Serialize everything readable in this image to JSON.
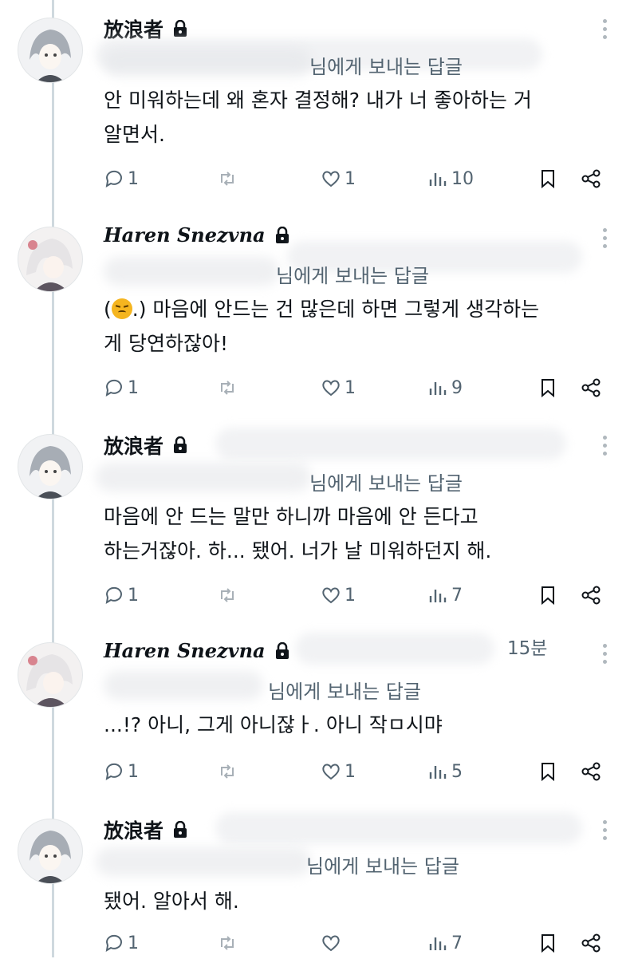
{
  "thread": [
    {
      "author": "放浪者",
      "author_style": "sans",
      "locked": true,
      "time": "",
      "reply_to": "님에게 보내는 답글",
      "text": "안 미워하는데 왜 혼자 결정해? 내가 너 좋아하는 거\n알면서.",
      "emoji_prefix": false,
      "text_after_emoji": "",
      "replies": "1",
      "retweets": "",
      "likes": "1",
      "views": "10"
    },
    {
      "author": "Haren Snezvna",
      "author_style": "serif",
      "locked": true,
      "time": "",
      "reply_to": "님에게 보내는 답글",
      "text": "(",
      "emoji_prefix": true,
      "text_after_emoji": ".) 마음에 안드는 건 많은데 하면 그렇게 생각하는\n게 당연하잖아!",
      "replies": "1",
      "retweets": "",
      "likes": "1",
      "views": "9"
    },
    {
      "author": "放浪者",
      "author_style": "sans",
      "locked": true,
      "time": "",
      "reply_to": "님에게 보내는 답글",
      "text": "마음에 안 드는 말만 하니까 마음에 안 든다고\n하는거잖아. 하... 됐어. 너가 날 미워하던지 해.",
      "emoji_prefix": false,
      "text_after_emoji": "",
      "replies": "1",
      "retweets": "",
      "likes": "1",
      "views": "7"
    },
    {
      "author": "Haren Snezvna",
      "author_style": "serif",
      "locked": true,
      "time": "15분",
      "reply_to": "님에게 보내는 답글",
      "text": "...!? 아니, 그게 아니잖ㅏ. 아니 작ㅁ시먀",
      "emoji_prefix": false,
      "text_after_emoji": "",
      "replies": "1",
      "retweets": "",
      "likes": "1",
      "views": "5"
    },
    {
      "author": "放浪者",
      "author_style": "sans",
      "locked": true,
      "time": "",
      "reply_to": "님에게 보내는 답글",
      "text": "됐어. 알아서 해.",
      "emoji_prefix": false,
      "text_after_emoji": "",
      "replies": "1",
      "retweets": "",
      "likes": "",
      "views": "7"
    }
  ],
  "colors": {
    "text": "#0f1419",
    "muted": "#536471",
    "line": "#cfd9de"
  },
  "icons": [
    "reply-icon",
    "retweet-icon",
    "like-icon",
    "views-icon",
    "bookmark-icon",
    "share-icon",
    "lock-icon",
    "more-icon"
  ]
}
